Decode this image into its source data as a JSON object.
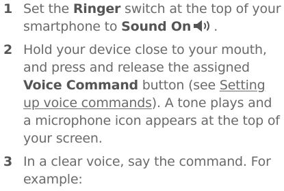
{
  "steps": [
    {
      "number": "1",
      "t1": "Set the ",
      "b1": "Ringer",
      "t2": " switch at the top of your smartphone to ",
      "b2": "Sound On",
      "t3": ".",
      "icon": "speaker-sound-on-icon"
    },
    {
      "number": "2",
      "t1": "Hold your device close to your mouth, and press and release the assigned ",
      "b1": "Voice Command",
      "t2": " button (see ",
      "link": "Setting up voice commands",
      "t3": "). A tone plays and a microphone icon appears at the top of your screen."
    },
    {
      "number": "3",
      "t1": "In a clear voice, say the command. For example:"
    }
  ]
}
